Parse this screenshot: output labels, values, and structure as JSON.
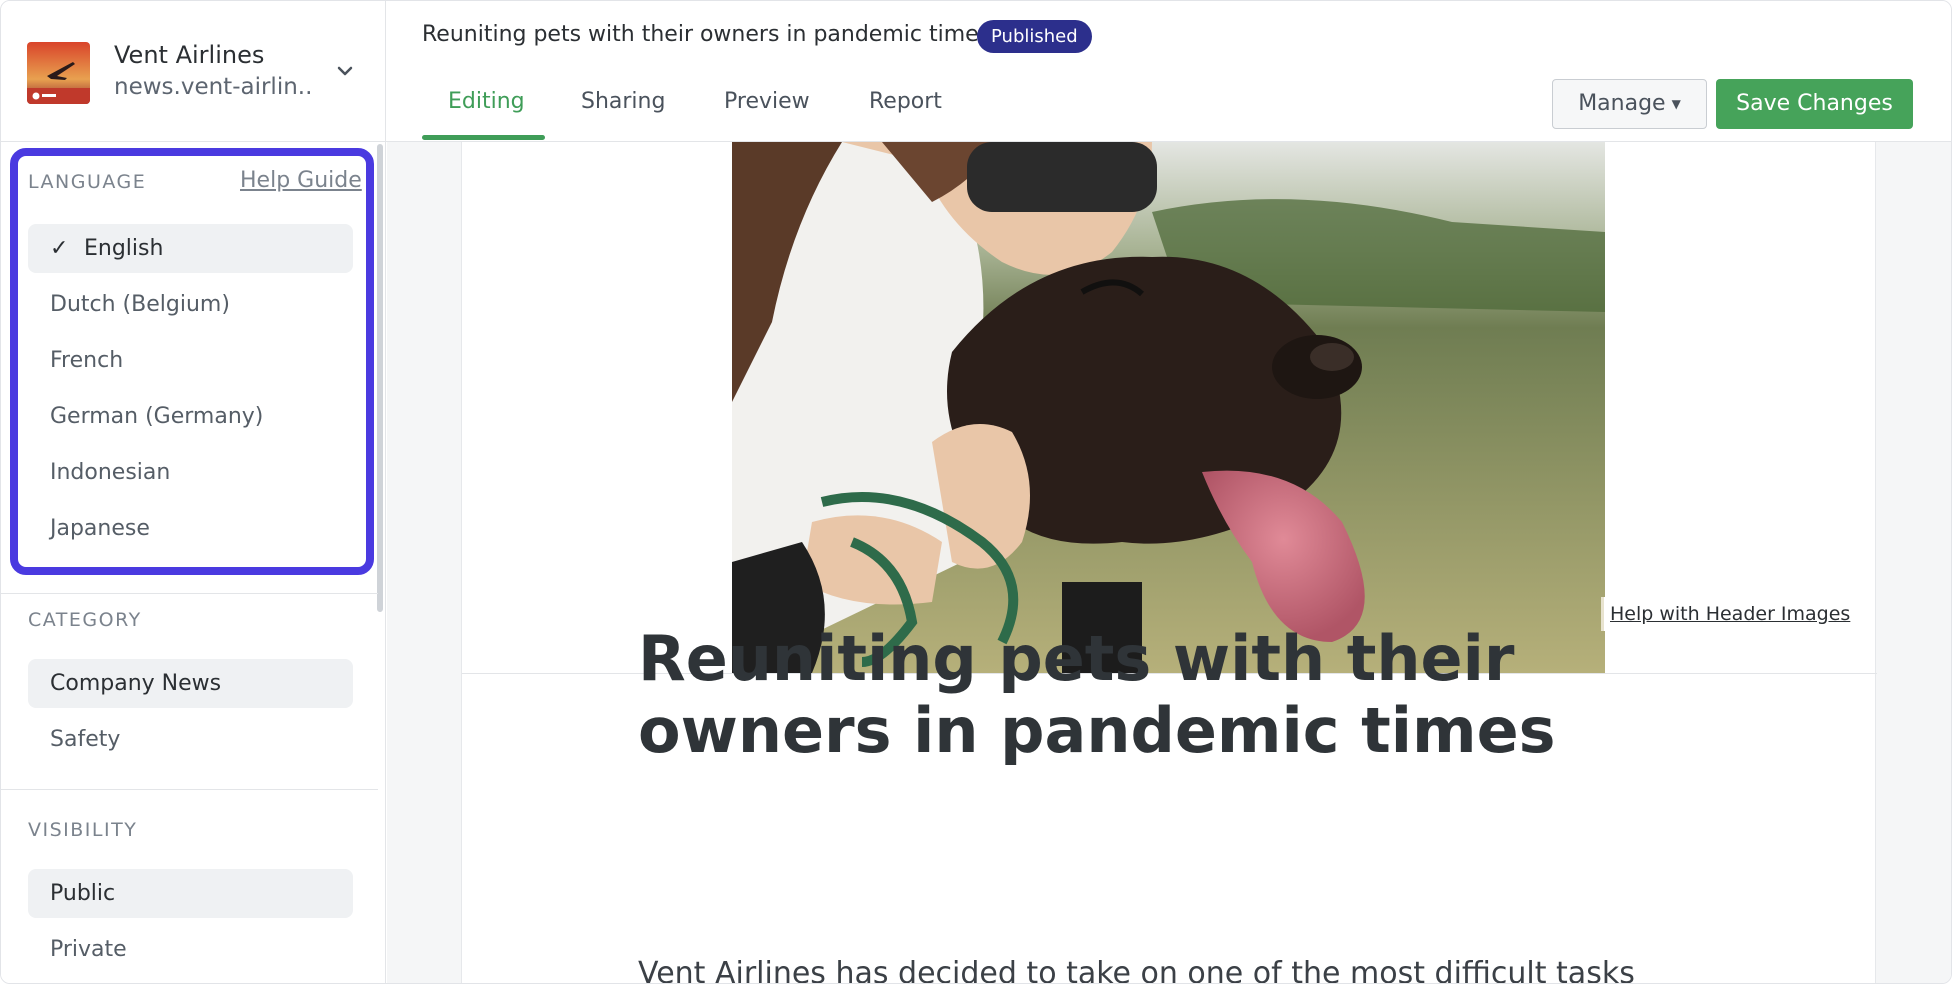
{
  "organization": {
    "name": "Vent Airlines",
    "url": "news.vent-airlin..."
  },
  "sidebar": {
    "language": {
      "label": "LANGUAGE",
      "help_link": "Help Guide",
      "selected_mark": "✓",
      "options": [
        "English",
        "Dutch (Belgium)",
        "French",
        "German (Germany)",
        "Indonesian",
        "Japanese"
      ]
    },
    "category": {
      "label": "CATEGORY",
      "options": [
        "Company News",
        "Safety"
      ]
    },
    "visibility": {
      "label": "VISIBILITY",
      "options": [
        "Public",
        "Private"
      ]
    }
  },
  "header": {
    "doc_title": "Reuniting pets with their owners in pandemic times",
    "status_badge": "Published",
    "tabs": [
      "Editing",
      "Sharing",
      "Preview",
      "Report"
    ],
    "active_tab": "Editing",
    "manage_label": "Manage",
    "save_label": "Save Changes"
  },
  "article": {
    "help_header_images": "Help with Header Images",
    "title": "Reuniting pets with their owners in pandemic times",
    "body_start": "Vent Airlines has decided to take on one of the most difficult tasks"
  },
  "colors": {
    "accent_green": "#46a35a",
    "badge_navy": "#2c2f8c",
    "highlight_purple": "#4a3ae0"
  }
}
